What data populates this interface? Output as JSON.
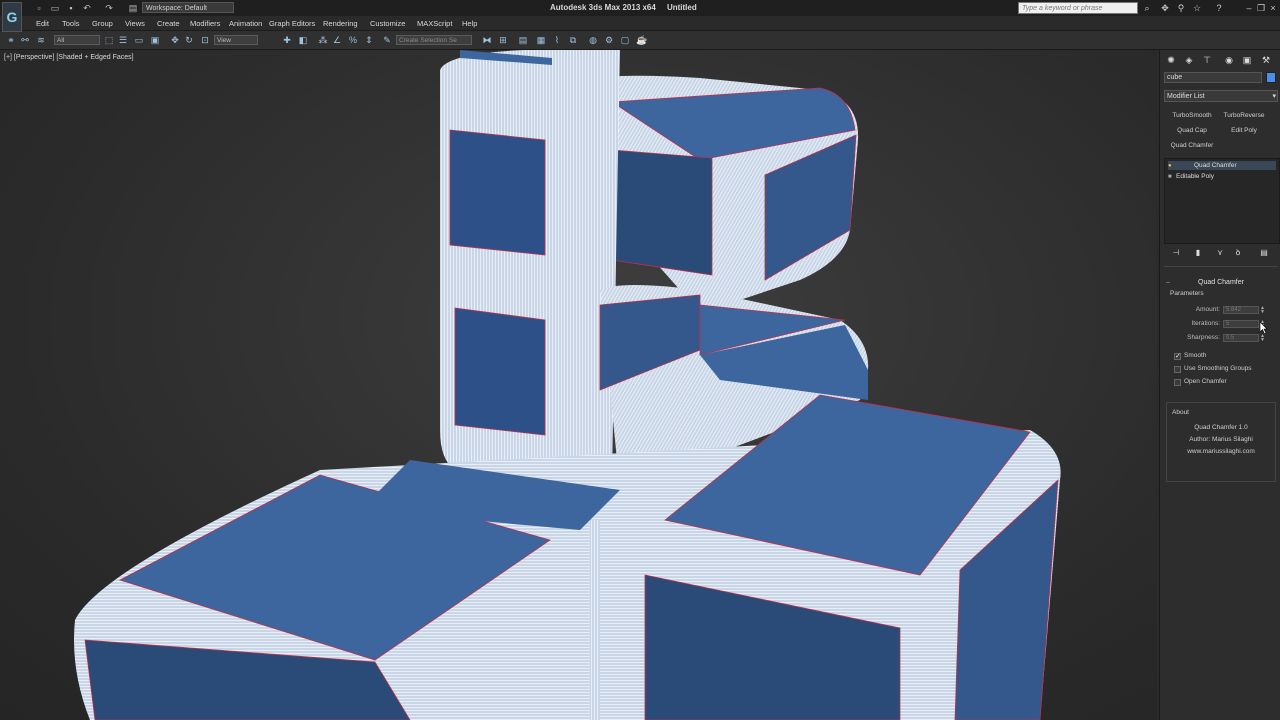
{
  "titlebar": {
    "workspace": "Workspace: Default",
    "title": "Autodesk 3ds Max  2013 x64",
    "doc": "Untitled",
    "search_placeholder": "Type a keyword or phrase"
  },
  "menu": [
    "Edit",
    "Tools",
    "Group",
    "Views",
    "Create",
    "Modifiers",
    "Animation",
    "Graph Editors",
    "Rendering",
    "Customize",
    "MAXScript",
    "Help"
  ],
  "toolbar": {
    "filter": "All",
    "refcoord": "View",
    "selection_set": "Create Selection Se"
  },
  "viewport": {
    "label": "[+] [Perspective] [Shaded + Edged Faces]"
  },
  "panel": {
    "object_name": "cube",
    "object_color": "#4a8fe8",
    "modifier_list": "Modifier List",
    "buttons": [
      "TurboSmooth",
      "TurboReverse",
      "Quad Cap",
      "Edit Poly",
      "Quad Chamfer"
    ],
    "stack": [
      "Quad Chamfer",
      "Editable Poly"
    ],
    "rollout_title": "Quad Chamfer",
    "parameters_label": "Parameters",
    "params": [
      {
        "label": "Amount:",
        "value": "5.642"
      },
      {
        "label": "Iterations:",
        "value": "5"
      },
      {
        "label": "Sharpness:",
        "value": "0.5"
      }
    ],
    "checks": [
      {
        "label": "Smooth",
        "checked": true
      },
      {
        "label": "Use Smoothing Groups",
        "checked": false
      },
      {
        "label": "Open Chamfer",
        "checked": false
      }
    ],
    "about_label": "About",
    "about": [
      "Quad Chamfer 1.0",
      "Author: Marius Silaghi",
      "www.mariussilaghi.com"
    ]
  },
  "colors": {
    "face_blue": "#3d659e",
    "face_blue_dark": "#2a4a78",
    "wire_white": "#eef3f8",
    "edge_red": "#c0304a"
  }
}
